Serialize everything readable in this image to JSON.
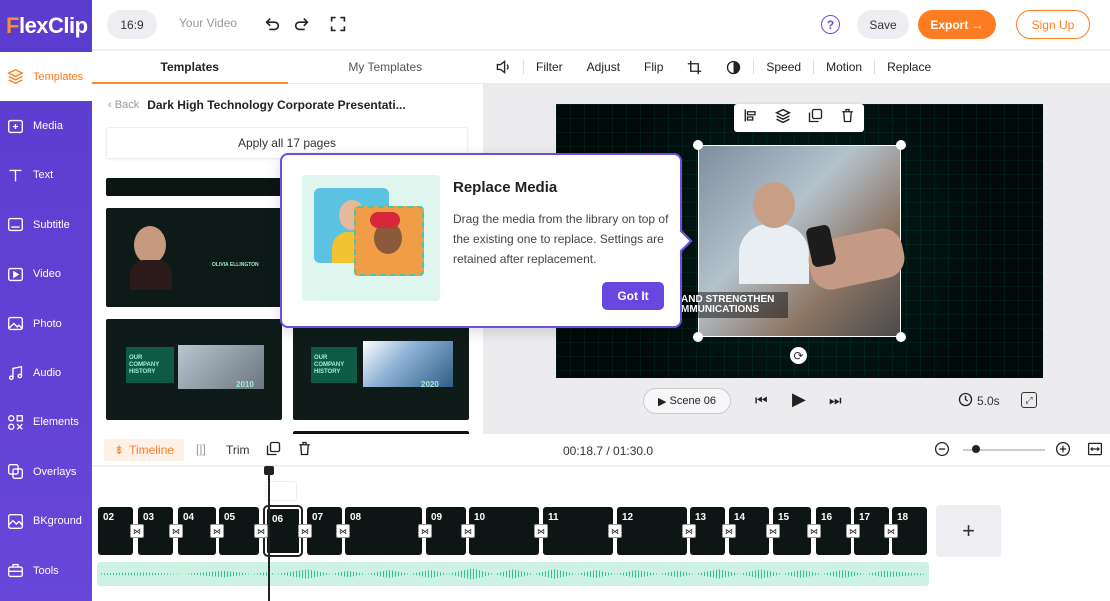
{
  "app": {
    "brand": "FlexClip",
    "brand_first": "F",
    "brand_rest": "lexClip"
  },
  "topbar": {
    "ratio": "16:9",
    "video_name": "Your Video",
    "help": "?",
    "save": "Save",
    "export": "Export →",
    "signup": "Sign Up"
  },
  "sidebar": {
    "items": [
      {
        "label": "Templates",
        "icon": "layers-icon"
      },
      {
        "label": "Media",
        "icon": "media-icon"
      },
      {
        "label": "Text",
        "icon": "text-icon"
      },
      {
        "label": "Subtitle",
        "icon": "subtitle-icon"
      },
      {
        "label": "Video",
        "icon": "video-icon"
      },
      {
        "label": "Photo",
        "icon": "photo-icon"
      },
      {
        "label": "Audio",
        "icon": "music-icon"
      },
      {
        "label": "Elements",
        "icon": "elements-icon"
      },
      {
        "label": "Overlays",
        "icon": "overlays-icon"
      },
      {
        "label": "BKground",
        "icon": "background-icon"
      },
      {
        "label": "Tools",
        "icon": "tools-icon"
      }
    ]
  },
  "panel": {
    "tabs": [
      "Templates",
      "My Templates"
    ],
    "back": "Back",
    "template_title": "Dark High Technology Corporate Presentati...",
    "apply_all": "Apply all 17 pages",
    "thumb_texts": {
      "t2_name": "OLIVIA ELLINGTON",
      "t3_title": "OUR COMPANY HISTORY",
      "t3_year": "2010",
      "t4_title": "OUR COMPANY HISTORY",
      "t4_year": "2020"
    }
  },
  "preview_toolbar": {
    "items": [
      "Filter",
      "Adjust",
      "Flip",
      "Speed",
      "Motion",
      "Replace"
    ]
  },
  "canvas": {
    "caption_line1": "AND STRENGTHEN",
    "caption_line2": "MMUNICATIONS"
  },
  "controls": {
    "scene": "Scene 06",
    "duration": "5.0s"
  },
  "popup": {
    "title": "Replace Media",
    "description": "Drag the media from the library on top of the existing one to replace. Settings are retained after replacement.",
    "button": "Got It"
  },
  "timeline": {
    "tab": "Timeline",
    "trim": "Trim",
    "time": "00:18.7 / 01:30.0",
    "clips": [
      "02",
      "03",
      "04",
      "05",
      "06",
      "07",
      "08",
      "09",
      "10",
      "11",
      "12",
      "13",
      "14",
      "15",
      "16",
      "17",
      "18"
    ],
    "add": "+"
  }
}
